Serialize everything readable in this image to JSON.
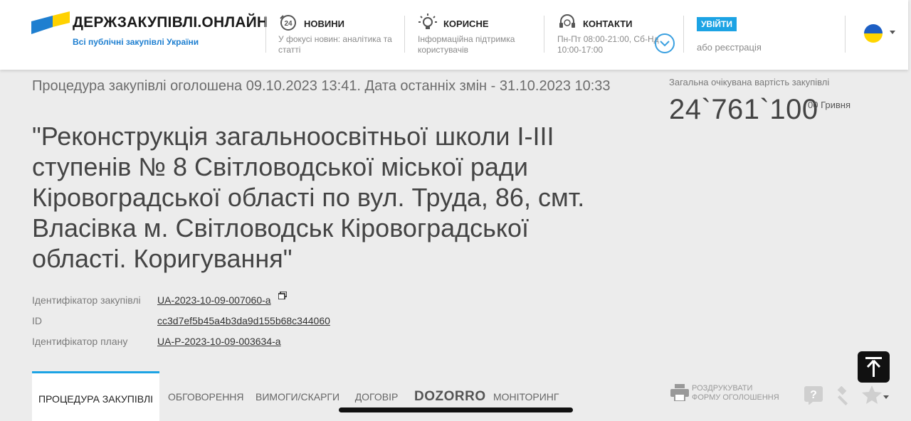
{
  "header": {
    "logo_title": "ДЕРЖЗАКУПІВЛІ.ОНЛАЙН",
    "logo_subtitle": "Всі публічні закупівлі України",
    "news": {
      "title": "НОВИНИ",
      "desc": "У фокусі новин: аналітика та статті",
      "icon": "news-24-icon"
    },
    "useful": {
      "title": "КОРИСНЕ",
      "desc": "Інформаційна підтримка користувачів",
      "icon": "lightbulb-icon"
    },
    "contacts": {
      "title": "КОНТАКТИ",
      "desc": "Пн-Пт 08:00-21:00, Сб-Нд 10:00-17:00",
      "icon": "headset-icon"
    },
    "login_label": "УВІЙТИ",
    "register_label": "або реєстрація",
    "accent_color": "#1ca3e4"
  },
  "procedure": {
    "announced": "Процедура закупівлі оголошена 09.10.2023 13:41. Дата останніх змін - 31.10.2023 10:33",
    "title": "\"Реконструкція загальноосвітньої школи I-III ступенів № 8 Світловодської міської ради Кіровоградської області по вул. Труда, 86, смт. Власівка м. Світловодськ Кіровоградської області. Коригування\"",
    "identifiers": [
      {
        "label": "Ідентифікатор закупівлі",
        "value": "UA-2023-10-09-007060-a"
      },
      {
        "label": "ID",
        "value": "cc3d7ef5b45a4b3da9d155b68c344060"
      },
      {
        "label": "Ідентифікатор плану",
        "value": "UA-P-2023-10-09-003634-a"
      }
    ]
  },
  "value": {
    "label": "Загальна очікувана вартість закупівлі",
    "amount": "24`761`100",
    "cents_currency": "00 Гривня"
  },
  "tabs": [
    {
      "label": "ПРОЦЕДУРА ЗАКУПІВЛІ",
      "active": true
    },
    {
      "label": "ОБГОВОРЕННЯ",
      "active": false
    },
    {
      "label": "ВИМОГИ/СКАРГИ",
      "active": false
    },
    {
      "label": "ДОГОВІР",
      "active": false
    },
    {
      "label": "DOZORRO",
      "active": false
    },
    {
      "label": "МОНІТОРИНГ",
      "active": false
    }
  ],
  "print": {
    "line1": "РОЗДРУКУВАТИ",
    "line2": "ФОРМУ ОГОЛОШЕННЯ"
  }
}
